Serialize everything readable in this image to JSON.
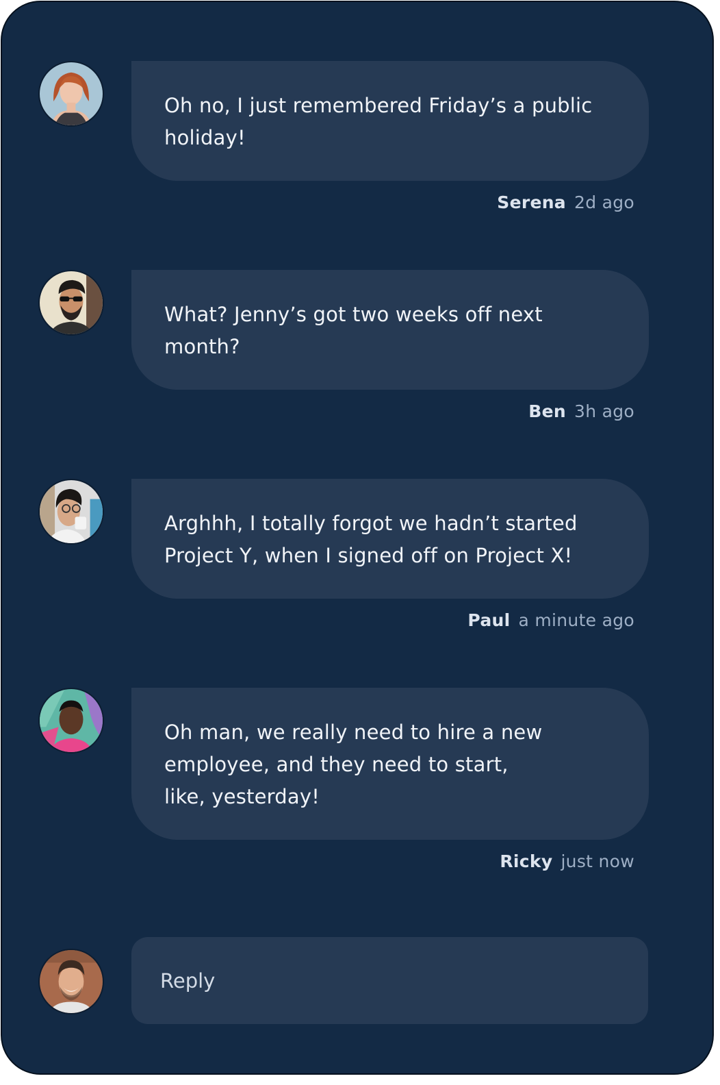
{
  "thread": {
    "messages": [
      {
        "author": "Serena",
        "time": "2d ago",
        "lines": [
          "Oh no, I just remembered Friday’s a public",
          "holiday!"
        ]
      },
      {
        "author": "Ben",
        "time": "3h ago",
        "lines": [
          "What? Jenny’s got two weeks off next",
          "month?"
        ]
      },
      {
        "author": "Paul",
        "time": "a minute ago",
        "lines": [
          "Arghhh, I totally forgot we hadn’t started",
          "Project Y, when I signed off on Project X!"
        ]
      },
      {
        "author": "Ricky",
        "time": "just now",
        "lines": [
          "Oh man, we really need to hire a new",
          "employee, and they need to start,",
          "like, yesterday!"
        ]
      }
    ]
  },
  "reply": {
    "placeholder": "Reply"
  },
  "colors": {
    "background": "#132a45",
    "bubble": "#263a54",
    "text": "#f1f4f8",
    "muted": "#9eafc5"
  }
}
